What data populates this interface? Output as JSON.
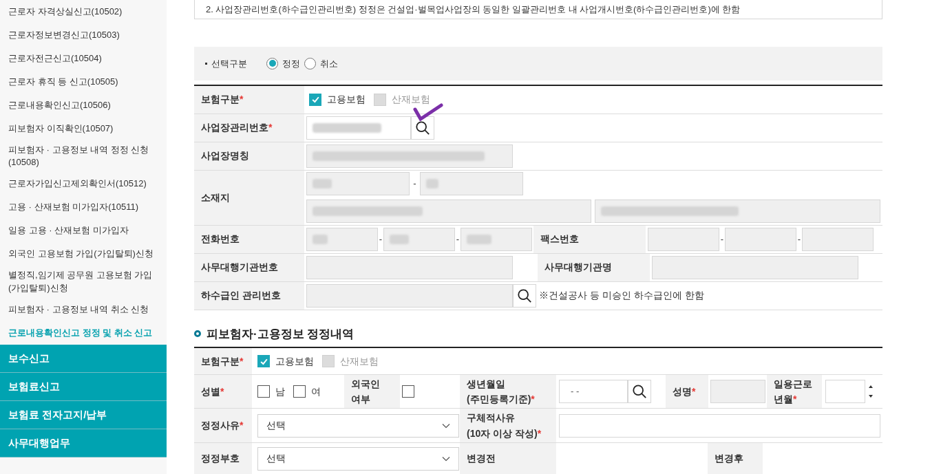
{
  "sidebar": {
    "items": [
      {
        "kind": "sub",
        "label": "근로자 자격상실신고(10502)",
        "selected": false
      },
      {
        "kind": "sub",
        "label": "근로자정보변경신고(10503)",
        "selected": false
      },
      {
        "kind": "sub",
        "label": "근로자전근신고(10504)",
        "selected": false
      },
      {
        "kind": "sub",
        "label": "근로자 휴직 등 신고(10505)",
        "selected": false
      },
      {
        "kind": "sub",
        "label": "근로내용확인신고(10506)",
        "selected": false
      },
      {
        "kind": "sub",
        "label": "피보험자 이직확인(10507)",
        "selected": false
      },
      {
        "kind": "sub",
        "label": "피보험자 · 고용정보 내역 정정 신청(10508)",
        "selected": false
      },
      {
        "kind": "sub",
        "label": "근로자가입신고제외확인서(10512)",
        "selected": false
      },
      {
        "kind": "sub",
        "label": "고용 · 산재보험 미가입자(10511)",
        "selected": false
      },
      {
        "kind": "sub",
        "label": "일용 고용 · 산재보험 미가입자",
        "selected": false
      },
      {
        "kind": "sub",
        "label": "외국인 고용보험 가입(가입탈퇴)신청",
        "selected": false
      },
      {
        "kind": "sub",
        "label": "별정직,임기제 공무원 고용보험 가입(가입탈퇴)신청",
        "selected": false
      },
      {
        "kind": "sub",
        "label": "피보험자 · 고용정보 내역 취소 신청",
        "selected": false
      },
      {
        "kind": "sub",
        "label": "근로내용확인신고 정정 및 취소 신고",
        "selected": true
      },
      {
        "kind": "group",
        "label": "보수신고",
        "selected": false
      },
      {
        "kind": "group",
        "label": "보험료신고",
        "selected": false
      },
      {
        "kind": "group",
        "label": "보험료 전자고지/납부",
        "selected": false
      },
      {
        "kind": "group",
        "label": "사무대행업무",
        "selected": false
      }
    ]
  },
  "notice": "2. 사업장관리번호(하수급인관리번호) 정정은 건설업·벌목업사업장의 동일한 일괄관리번호 내 사업개시번호(하수급인관리번호)에 한함",
  "selector": {
    "label": "선택구분",
    "options": [
      {
        "label": "정정",
        "selected": true
      },
      {
        "label": "취소",
        "selected": false
      }
    ]
  },
  "workplace": {
    "rows": [
      {
        "kind": "insurance",
        "label": "보험구분",
        "required_mark": "*",
        "options": [
          {
            "label": "고용보험",
            "checked": true,
            "disabled": false
          },
          {
            "label": "산재보험",
            "checked": false,
            "disabled": true
          }
        ]
      },
      {
        "kind": "search",
        "label": "사업장관리번호",
        "required_mark": "*",
        "blurred": true
      },
      {
        "kind": "text",
        "label": "사업장명칭",
        "blurred": true
      },
      {
        "kind": "address",
        "label": "소재지",
        "separator": "-",
        "blurred": true
      },
      {
        "kind": "phone",
        "label": "전화번호",
        "separators": [
          "-",
          "-"
        ],
        "label2": "팩스번호",
        "separators2": [
          "-",
          "-"
        ],
        "blurred": true
      },
      {
        "kind": "pair",
        "label": "사무대행기관번호",
        "label2": "사무대행기관명",
        "blurred": false
      },
      {
        "kind": "search_note",
        "label": "하수급인 관리번호",
        "note": "※건설공사 등 미승인 하수급인에 한함",
        "blurred": false
      }
    ]
  },
  "insured": {
    "title": "피보험자·고용정보 정정내역",
    "insurance": {
      "label": "보험구분",
      "required_mark": "*",
      "options": [
        {
          "label": "고용보험",
          "checked": true,
          "disabled": false
        },
        {
          "label": "산재보험",
          "checked": false,
          "disabled": true
        }
      ]
    },
    "gender": {
      "label": "성별",
      "required_mark": "*",
      "options": [
        {
          "label": "남",
          "checked": false
        },
        {
          "label": "여",
          "checked": false
        }
      ]
    },
    "foreigner": {
      "lines": [
        "외국인",
        "여부"
      ],
      "checked": false
    },
    "birth": {
      "lines": [
        "생년월일",
        "(주민등록기준)"
      ],
      "required_mark": "*",
      "value": "- -"
    },
    "name": {
      "label": "성명",
      "required_mark": "*"
    },
    "day_work": {
      "lines": [
        "일용근로",
        "년월"
      ],
      "required_mark": "*"
    },
    "reason": {
      "label": "정정사유",
      "required_mark": "*",
      "select": "선택"
    },
    "detail": {
      "lines": [
        "구체적사유",
        "(10자 이상 작성)"
      ],
      "required_mark": "*"
    },
    "code": {
      "label": "정정부호",
      "select": "선택"
    },
    "before": {
      "label": "변경전"
    },
    "after": {
      "label": "변경후"
    }
  }
}
